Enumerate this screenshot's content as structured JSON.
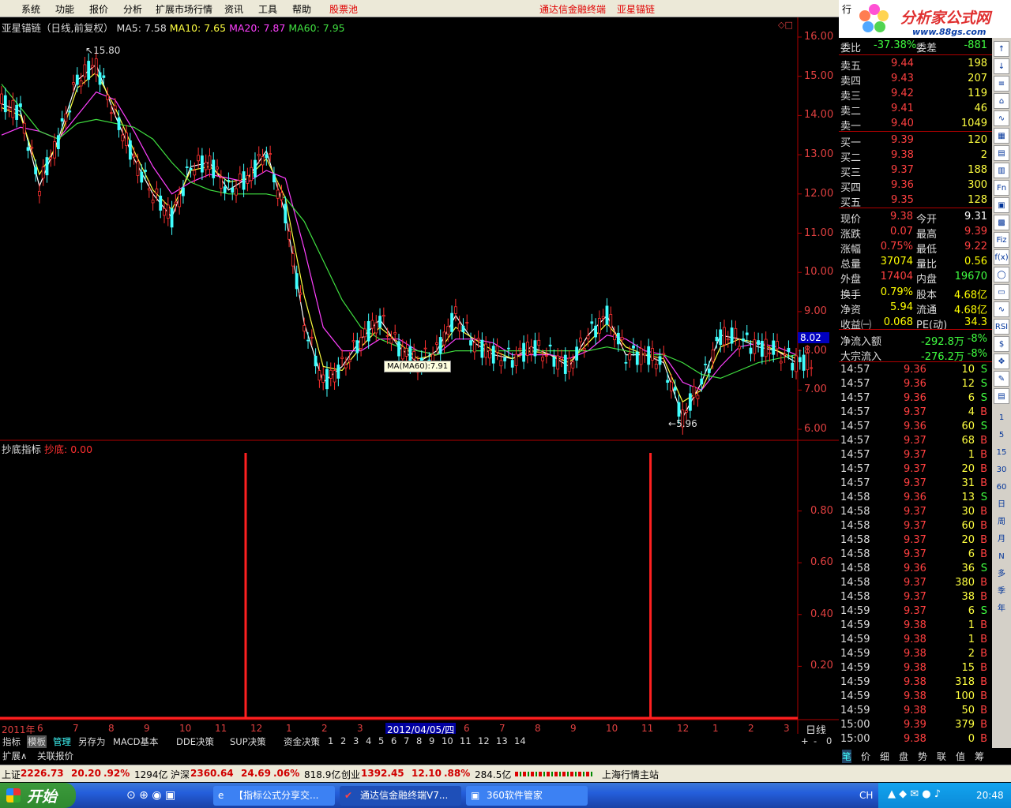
{
  "menu": [
    "系统",
    "功能",
    "报价",
    "分析",
    "扩展市场行情",
    "资讯",
    "工具",
    "帮助",
    "股票池"
  ],
  "menu_red": [
    "通达信金融终端",
    "亚星锚链"
  ],
  "header_right_label": "行",
  "logo": {
    "title": "分析家公式网",
    "url": "www.88gs.com"
  },
  "chart_title": {
    "name": "亚星锚链（日线,前复权）",
    "ma5_label": "MA5:",
    "ma5": "7.58",
    "ma10_label": "MA10:",
    "ma10": "7.65",
    "ma20_label": "MA20:",
    "ma20": "7.87",
    "ma60_label": "MA60:",
    "ma60": "7.95"
  },
  "indicator_title": {
    "name": "抄底指标",
    "label": "抄底:",
    "value": "0.00"
  },
  "price_axis": [
    "16.00",
    "15.00",
    "14.00",
    "13.00",
    "12.00",
    "11.00",
    "10.00",
    "9.00",
    "8.00",
    "7.00",
    "6.00"
  ],
  "current_price_tag": "8.02",
  "annotations": {
    "high": "15.80",
    "low": "5.96",
    "ma_tip": "MA(MA60):7.91"
  },
  "indicator_axis": [
    "0.80",
    "0.60",
    "0.40",
    "0.20"
  ],
  "date_axis": [
    "2011年",
    "6",
    "7",
    "8",
    "9",
    "10",
    "11",
    "12",
    "1",
    "2",
    "3",
    "4",
    "5",
    "6",
    "7",
    "8",
    "9",
    "10",
    "11",
    "12",
    "1",
    "2",
    "3"
  ],
  "cursor_date": "2012/04/05/四",
  "period_label": "日线",
  "chart_data": {
    "type": "line",
    "title": "亚星锚链（日线,前复权）",
    "ylim": [
      5.8,
      16.1
    ],
    "series": [
      {
        "name": "MA5",
        "values": [
          14.3,
          14.1,
          12.2,
          13.4,
          14.9,
          15.3,
          14.0,
          12.9,
          12.0,
          11.4,
          12.7,
          12.8,
          12.1,
          12.4,
          13.1,
          11.5,
          8.7,
          7.2,
          7.6,
          8.3,
          8.8,
          8.1,
          7.7,
          8.0,
          8.9,
          8.2,
          7.9,
          7.8,
          8.1,
          7.9,
          7.6,
          8.4,
          8.9,
          7.9,
          7.9,
          7.7,
          6.3,
          7.2,
          8.4,
          8.3,
          8.1,
          8.0,
          7.7
        ]
      },
      {
        "name": "MA10",
        "values": [
          14.2,
          14.0,
          12.5,
          13.3,
          14.7,
          15.1,
          14.2,
          13.1,
          12.1,
          11.6,
          12.6,
          12.7,
          12.3,
          12.4,
          12.9,
          11.9,
          9.4,
          7.6,
          7.5,
          8.1,
          8.6,
          8.2,
          7.8,
          7.9,
          8.6,
          8.3,
          8.0,
          7.8,
          8.0,
          7.9,
          7.7,
          8.2,
          8.7,
          8.1,
          7.9,
          7.8,
          6.7,
          7.0,
          8.1,
          8.3,
          8.2,
          8.0,
          7.8
        ]
      },
      {
        "name": "MA20",
        "values": [
          13.5,
          13.7,
          13.6,
          13.4,
          14.0,
          14.6,
          14.4,
          13.6,
          12.7,
          12.0,
          12.3,
          12.5,
          12.4,
          12.3,
          12.6,
          12.4,
          10.6,
          8.6,
          8.0,
          8.0,
          8.3,
          8.3,
          8.0,
          7.9,
          8.3,
          8.3,
          8.2,
          7.9,
          7.9,
          7.9,
          7.8,
          8.0,
          8.4,
          8.3,
          8.0,
          7.9,
          7.2,
          7.0,
          7.6,
          8.1,
          8.2,
          8.1,
          7.9
        ]
      },
      {
        "name": "MA60",
        "values": [
          14.8,
          14.2,
          13.6,
          13.4,
          13.8,
          13.9,
          13.8,
          13.7,
          13.4,
          12.8,
          12.3,
          12.1,
          12.0,
          12.0,
          12.0,
          11.9,
          11.3,
          10.3,
          9.3,
          8.6,
          8.3,
          8.1,
          8.0,
          7.9,
          8.0,
          8.0,
          8.0,
          8.0,
          8.0,
          8.0,
          8.0,
          8.0,
          8.1,
          8.0,
          7.9,
          7.9,
          7.7,
          7.4,
          7.3,
          7.5,
          7.7,
          7.8,
          7.9
        ]
      }
    ],
    "indicator": {
      "name": "抄底",
      "ylim": [
        0,
        1
      ],
      "spikes_at": [
        12.9,
        34.3
      ],
      "value": 1.0
    }
  },
  "bottom_tabs": [
    "指标",
    "模板",
    "管理",
    "另存为",
    "MACD基本",
    "DDE决策",
    "SUP决策",
    "资金决策",
    "1",
    "2",
    "3",
    "4",
    "5",
    "6",
    "7",
    "8",
    "9",
    "10",
    "11",
    "12",
    "13",
    "14"
  ],
  "bottom_tabs_right": [
    "+",
    "-",
    "0"
  ],
  "bottom_tabs2": [
    "扩展∧",
    "关联报价"
  ],
  "right_tabs": [
    "笔",
    "价",
    "细",
    "盘",
    "势",
    "联",
    "值",
    "筹"
  ],
  "quote": {
    "weibi": {
      "label": "委比",
      "value": "-37.38%",
      "label2": "委差",
      "value2": "-881"
    },
    "asks": [
      {
        "label": "卖五",
        "price": "9.44",
        "vol": "198"
      },
      {
        "label": "卖四",
        "price": "9.43",
        "vol": "207"
      },
      {
        "label": "卖三",
        "price": "9.42",
        "vol": "119"
      },
      {
        "label": "卖二",
        "price": "9.41",
        "vol": "46"
      },
      {
        "label": "卖一",
        "price": "9.40",
        "vol": "1049"
      }
    ],
    "bids": [
      {
        "label": "买一",
        "price": "9.39",
        "vol": "120"
      },
      {
        "label": "买二",
        "price": "9.38",
        "vol": "2"
      },
      {
        "label": "买三",
        "price": "9.37",
        "vol": "188"
      },
      {
        "label": "买四",
        "price": "9.36",
        "vol": "300"
      },
      {
        "label": "买五",
        "price": "9.35",
        "vol": "128"
      }
    ],
    "stats": [
      {
        "l1": "现价",
        "v1": "9.38",
        "l2": "今开",
        "v2": "9.31",
        "c1": "#ff4040",
        "c2": "#fff"
      },
      {
        "l1": "涨跌",
        "v1": "0.07",
        "l2": "最高",
        "v2": "9.39",
        "c1": "#ff4040",
        "c2": "#ff4040"
      },
      {
        "l1": "涨幅",
        "v1": "0.75%",
        "l2": "最低",
        "v2": "9.22",
        "c1": "#ff4040",
        "c2": "#ff4040"
      },
      {
        "l1": "总量",
        "v1": "37074",
        "l2": "量比",
        "v2": "0.56",
        "c1": "#ffff00",
        "c2": "#ffff00"
      },
      {
        "l1": "外盘",
        "v1": "17404",
        "l2": "内盘",
        "v2": "19670",
        "c1": "#ff4040",
        "c2": "#40ff40"
      },
      {
        "l1": "换手",
        "v1": "0.79%",
        "l2": "股本",
        "v2": "4.68亿",
        "c1": "#ffff00",
        "c2": "#ffff00"
      },
      {
        "l1": "净资",
        "v1": "5.94",
        "l2": "流通",
        "v2": "4.68亿",
        "c1": "#ffff00",
        "c2": "#ffff00"
      },
      {
        "l1": "收益㈠",
        "v1": "0.068",
        "l2": "PE(动)",
        "v2": "34.3",
        "c1": "#ffff00",
        "c2": "#ffff00"
      }
    ],
    "flow": [
      {
        "label": "净流入额",
        "v1": "-292.8万",
        "v2": "-8%"
      },
      {
        "label": "大宗流入",
        "v1": "-276.2万",
        "v2": "-8%"
      }
    ],
    "ticks": [
      [
        "14:57",
        "9.36",
        "10",
        "S"
      ],
      [
        "14:57",
        "9.36",
        "12",
        "S"
      ],
      [
        "14:57",
        "9.36",
        "6",
        "S"
      ],
      [
        "14:57",
        "9.37",
        "4",
        "B"
      ],
      [
        "14:57",
        "9.36",
        "60",
        "S"
      ],
      [
        "14:57",
        "9.37",
        "68",
        "B"
      ],
      [
        "14:57",
        "9.37",
        "1",
        "B"
      ],
      [
        "14:57",
        "9.37",
        "20",
        "B"
      ],
      [
        "14:57",
        "9.37",
        "31",
        "B"
      ],
      [
        "14:58",
        "9.36",
        "13",
        "S"
      ],
      [
        "14:58",
        "9.37",
        "30",
        "B"
      ],
      [
        "14:58",
        "9.37",
        "60",
        "B"
      ],
      [
        "14:58",
        "9.37",
        "20",
        "B"
      ],
      [
        "14:58",
        "9.37",
        "6",
        "B"
      ],
      [
        "14:58",
        "9.36",
        "36",
        "S"
      ],
      [
        "14:58",
        "9.37",
        "380",
        "B"
      ],
      [
        "14:58",
        "9.37",
        "38",
        "B"
      ],
      [
        "14:59",
        "9.37",
        "6",
        "S"
      ],
      [
        "14:59",
        "9.38",
        "1",
        "B"
      ],
      [
        "14:59",
        "9.38",
        "1",
        "B"
      ],
      [
        "14:59",
        "9.38",
        "2",
        "B"
      ],
      [
        "14:59",
        "9.38",
        "15",
        "B"
      ],
      [
        "14:59",
        "9.38",
        "318",
        "B"
      ],
      [
        "14:59",
        "9.38",
        "100",
        "B"
      ],
      [
        "14:59",
        "9.38",
        "50",
        "B"
      ],
      [
        "15:00",
        "9.39",
        "379",
        "B"
      ],
      [
        "15:00",
        "9.38",
        "0",
        "B"
      ]
    ]
  },
  "right_sidebar": [
    "1",
    "5",
    "15",
    "30",
    "60",
    "日",
    "周",
    "月",
    "N",
    "多",
    "季",
    "年"
  ],
  "statusbar": {
    "sh_label": "上证",
    "sh": "2226.73",
    "sh_chg": "20.20",
    "sh_pct": ".92%",
    "sh_amt": "1294亿",
    "sz_label": "沪深",
    "sz": "2360.64",
    "sz_chg": "24.69",
    "sz_pct": ".06%",
    "sz_amt": "818.9亿",
    "cy_label": "创业",
    "cy": "1392.45",
    "cy_chg": "12.10",
    "cy_pct": ".88%",
    "cy_amt": "284.5亿",
    "server": "上海行情主站"
  },
  "taskbar": {
    "start": "开始",
    "tasks": [
      "【指标公式分享交...",
      "通达信金融终端V7...",
      "360软件管家"
    ],
    "ime": "CH",
    "clock": "20:48"
  }
}
